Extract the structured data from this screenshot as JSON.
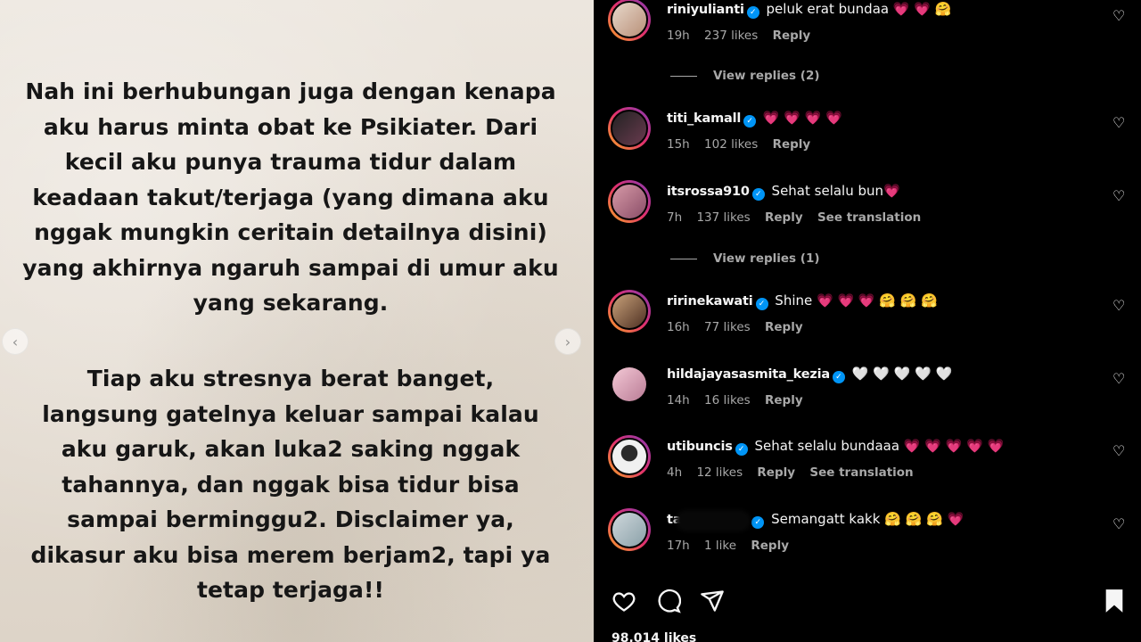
{
  "post": {
    "paragraph1": "Nah ini berhubungan juga dengan kenapa\naku harus minta obat ke Psikiater. Dari\nkecil aku punya trauma tidur dalam\nkeadaan takut/terjaga (yang dimana aku\nnggak mungkin ceritain detailnya disini)\nyang akhirnya ngaruh sampai di umur aku\nyang sekarang.",
    "paragraph2": "Tiap aku stresnya berat banget,\nlangsung gatelnya keluar sampai kalau\naku garuk, akan luka2 saking nggak\ntahannya, dan nggak bisa tidur bisa\nsampai berminggu2. Disclaimer ya,\ndikasur aku bisa merem berjam2, tapi ya\ntetap terjaga!!",
    "prev_arrow": "‹",
    "next_arrow": "›"
  },
  "colors": {
    "background": "#000000",
    "text": "#f5f5f5",
    "muted": "#a8a8a8",
    "verified": "#0095f6",
    "pink_heart": "#ff3d7a"
  },
  "comments": [
    {
      "username": "riniyulianti",
      "verified": true,
      "text": "peluk erat bundaa 💗 💗 🤗",
      "age": "19h",
      "likes": "237 likes",
      "reply": "Reply",
      "translation": ""
    },
    {
      "username": "titi_kamall",
      "verified": true,
      "text": "💗 💗 💗 💗",
      "age": "15h",
      "likes": "102 likes",
      "reply": "Reply",
      "translation": ""
    },
    {
      "username": "itsrossa910",
      "verified": true,
      "text": "Sehat selalu bun💗",
      "age": "7h",
      "likes": "137 likes",
      "reply": "Reply",
      "translation": "See translation"
    },
    {
      "username": "ririnekawati",
      "verified": true,
      "text": "Shine 💗 💗 💗 🤗 🤗 🤗",
      "age": "16h",
      "likes": "77 likes",
      "reply": "Reply",
      "translation": ""
    },
    {
      "username": "hildajayasasmita_kezia",
      "verified": true,
      "text": "🤍 🤍 🤍 🤍 🤍",
      "age": "14h",
      "likes": "16 likes",
      "reply": "Reply",
      "translation": ""
    },
    {
      "username": "utibuncis",
      "verified": true,
      "text": "Sehat selalu bundaaa 💗 💗 💗 💗 💗",
      "age": "4h",
      "likes": "12 likes",
      "reply": "Reply",
      "translation": "See translation"
    },
    {
      "username": "ta",
      "verified": true,
      "text": "Semangatt kakk 🤗 🤗 🤗 💗",
      "age": "17h",
      "likes": "1 like",
      "reply": "Reply",
      "translation": ""
    }
  ],
  "view_replies": [
    "View replies (2)",
    "View replies (1)"
  ],
  "actions": {
    "like_icon": "heart-outline-icon",
    "comment_icon": "comment-bubble-icon",
    "share_icon": "paper-plane-icon",
    "save_icon": "bookmark-icon"
  },
  "likes_total": "98,014 likes"
}
